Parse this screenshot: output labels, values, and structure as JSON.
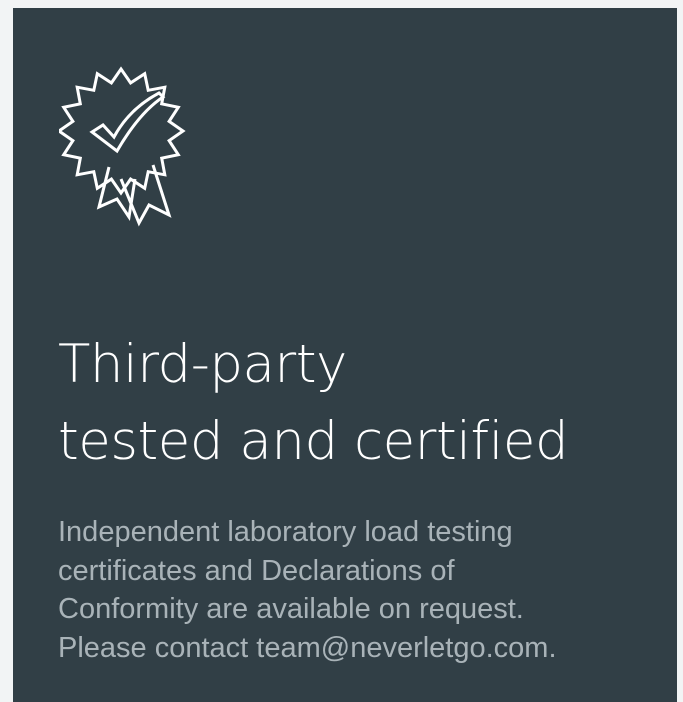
{
  "card": {
    "icon": "certified-rosette-check-icon",
    "title_lines": [
      "Third-party",
      "tested and certified"
    ],
    "body_lines": [
      "Independent laboratory load testing",
      "certificates and Declarations of",
      "Conformity are available on request.",
      "Please contact team@neverletgo.com."
    ]
  },
  "colors": {
    "page_background": "#f2f4f5",
    "card_background": "#313f46",
    "title_text": "#ffffff",
    "body_text": "#a9b3b8"
  }
}
